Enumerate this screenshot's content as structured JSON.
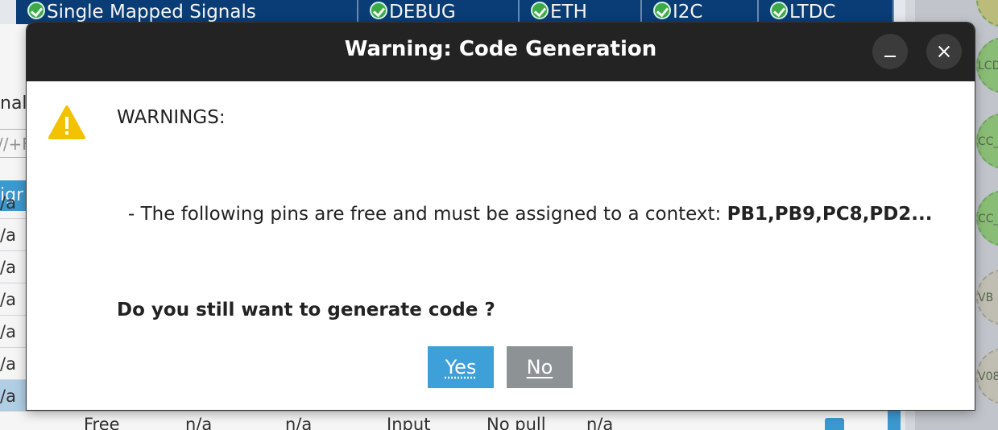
{
  "tabs": [
    {
      "label": "Single Mapped Signals"
    },
    {
      "label": "DEBUG"
    },
    {
      "label": "ETH"
    },
    {
      "label": "I2C"
    },
    {
      "label": "LTDC"
    }
  ],
  "left_panel": {
    "label_fragment": "nal",
    "filter_fragment": "//+F",
    "header_fragment": "igr",
    "rows": [
      "/a",
      "/a",
      "/a",
      "/a",
      "/a",
      "/a",
      "/a"
    ]
  },
  "bottom_row": {
    "cells": [
      "Free",
      "n/a",
      "n/a",
      "Input",
      "No pull",
      "n/a"
    ]
  },
  "chip_pins": [
    "LCD",
    "CC_",
    "CC_",
    "VB",
    "V08"
  ],
  "dialog": {
    "title": "Warning: Code Generation",
    "heading": "WARNINGS:",
    "message_prefix": "- The following pins are free and must be assigned to a context: ",
    "message_pins": "PB1,PB9,PC8,PD2...",
    "question": "Do you still want to generate code ?",
    "yes_label": "Yes",
    "no_label": "No"
  },
  "colors": {
    "tab_bar": "#0b3f7a",
    "accent": "#3ea0d8",
    "title_bar": "#232323",
    "no_button": "#8d9295",
    "warning_icon": "#f2c200"
  }
}
